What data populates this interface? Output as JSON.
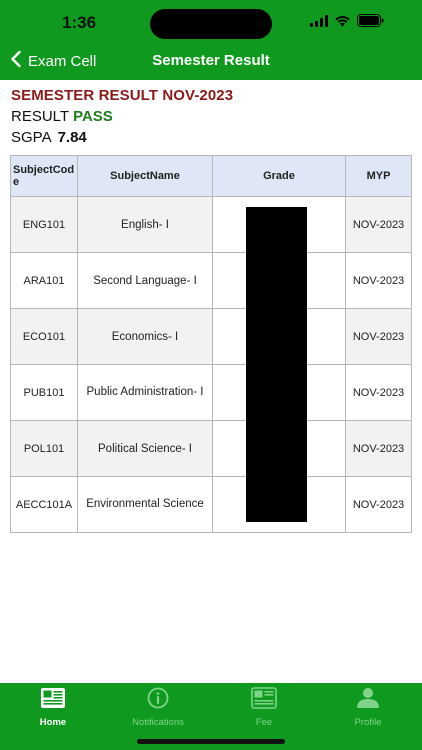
{
  "status_bar": {
    "time": "1:36"
  },
  "nav": {
    "back_label": "Exam Cell",
    "title": "Semester Result"
  },
  "result": {
    "heading": "SEMESTER RESULT NOV-2023",
    "result_label": "RESULT",
    "result_value": "PASS",
    "sgpa_label": "SGPA",
    "sgpa_value": "7.84"
  },
  "table": {
    "headers": [
      "SubjectCode",
      "SubjectName",
      "Grade",
      "MYP"
    ],
    "rows": [
      {
        "code": "ENG101",
        "name": "English- I",
        "grade": "",
        "myp": "NOV-2023"
      },
      {
        "code": "ARA101",
        "name": "Second Language- I",
        "grade": "",
        "myp": "NOV-2023"
      },
      {
        "code": "ECO101",
        "name": "Economics- I",
        "grade": "",
        "myp": "NOV-2023"
      },
      {
        "code": "PUB101",
        "name": "Public Administration- I",
        "grade": "",
        "myp": "NOV-2023"
      },
      {
        "code": "POL101",
        "name": "Political Science- I",
        "grade": "",
        "myp": "NOV-2023"
      },
      {
        "code": "AECC101A",
        "name": "Environmental Science",
        "grade": "",
        "myp": "NOV-2023"
      }
    ]
  },
  "tabs": [
    {
      "label": "Home",
      "icon": "home-icon",
      "active": true
    },
    {
      "label": "Notifications",
      "icon": "info-icon",
      "active": false
    },
    {
      "label": "Fee",
      "icon": "fee-icon",
      "active": false
    },
    {
      "label": "Profile",
      "icon": "profile-icon",
      "active": false
    }
  ],
  "colors": {
    "brand_green": "#0f9a1f",
    "heading_red": "#8b1a1a",
    "pass_green": "#1e7d1e",
    "header_blue": "#dfe6f6"
  }
}
